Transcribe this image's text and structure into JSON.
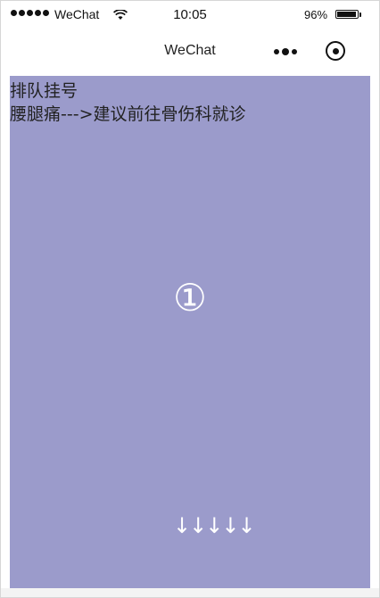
{
  "status_bar": {
    "carrier": "WeChat",
    "time": "10:05",
    "battery_text": "96%",
    "battery_level": 0.96
  },
  "nav": {
    "title": "WeChat"
  },
  "content": {
    "heading": "排队挂号",
    "advice": "腰腿痛--->建议前往骨伤科就诊",
    "queue_number": "①",
    "arrows": "↓↓↓↓↓",
    "background_color": "#9b9bcb"
  }
}
